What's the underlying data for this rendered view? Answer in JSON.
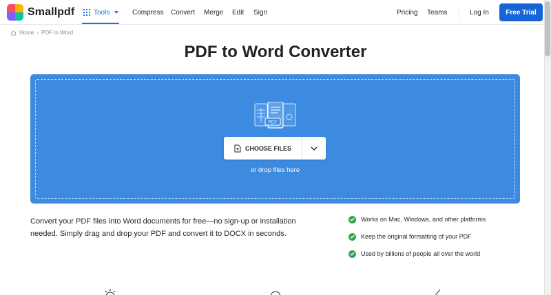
{
  "header": {
    "brand": "Smallpdf",
    "tools_label": "Tools",
    "nav": [
      "Compress",
      "Convert",
      "Merge",
      "Edit",
      "Sign"
    ],
    "pricing": "Pricing",
    "teams": "Teams",
    "login": "Log In",
    "trial": "Free Trial"
  },
  "breadcrumb": {
    "home": "Home",
    "current": "PDF to Word"
  },
  "title": "PDF to Word Converter",
  "dropzone": {
    "choose_label": "CHOOSE FILES",
    "drop_hint": "or drop files here",
    "illustration_badge": "PDF"
  },
  "description": "Convert your PDF files into Word documents for free—no sign-up or installation needed. Simply drag and drop your PDF and convert it to DOCX in seconds.",
  "features": [
    "Works on Mac, Windows, and other platforms",
    "Keep the original formatting of your PDF",
    "Used by billions of people all over the world"
  ],
  "colors": {
    "accent": "#1565d8",
    "dropzone": "#3d8be0",
    "check": "#2ea44f"
  }
}
